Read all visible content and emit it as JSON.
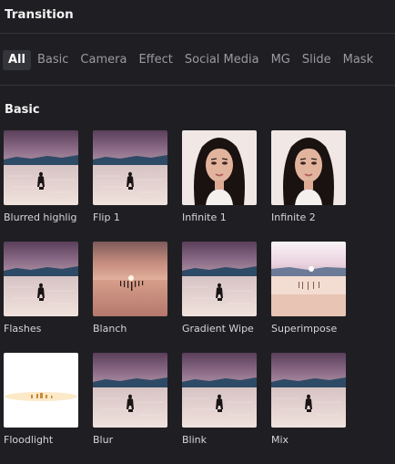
{
  "panel": {
    "title": "Transition"
  },
  "tabs": [
    {
      "label": "All",
      "active": true
    },
    {
      "label": "Basic",
      "active": false
    },
    {
      "label": "Camera",
      "active": false
    },
    {
      "label": "Effect",
      "active": false
    },
    {
      "label": "Social Media",
      "active": false
    },
    {
      "label": "MG",
      "active": false
    },
    {
      "label": "Slide",
      "active": false
    },
    {
      "label": "Mask",
      "active": false
    }
  ],
  "section": {
    "title": "Basic"
  },
  "items": [
    {
      "label": "Blurred highlig",
      "thumb": "lake-silhouette"
    },
    {
      "label": "Flip 1",
      "thumb": "lake-silhouette"
    },
    {
      "label": "Infinite 1",
      "thumb": "portrait"
    },
    {
      "label": "Infinite 2",
      "thumb": "portrait"
    },
    {
      "label": "Flashes",
      "thumb": "lake-silhouette"
    },
    {
      "label": "Blanch",
      "thumb": "sunset-pier"
    },
    {
      "label": "Gradient Wipe",
      "thumb": "lake-silhouette"
    },
    {
      "label": "Superimpose",
      "thumb": "bright-pier"
    },
    {
      "label": "Floodlight",
      "thumb": "white-flash"
    },
    {
      "label": "Blur",
      "thumb": "lake-silhouette"
    },
    {
      "label": "Blink",
      "thumb": "lake-silhouette"
    },
    {
      "label": "Mix",
      "thumb": "lake-silhouette"
    }
  ],
  "colors": {
    "background": "#1f1f23",
    "active_tab": "#34343b",
    "divider": "#34343a"
  }
}
